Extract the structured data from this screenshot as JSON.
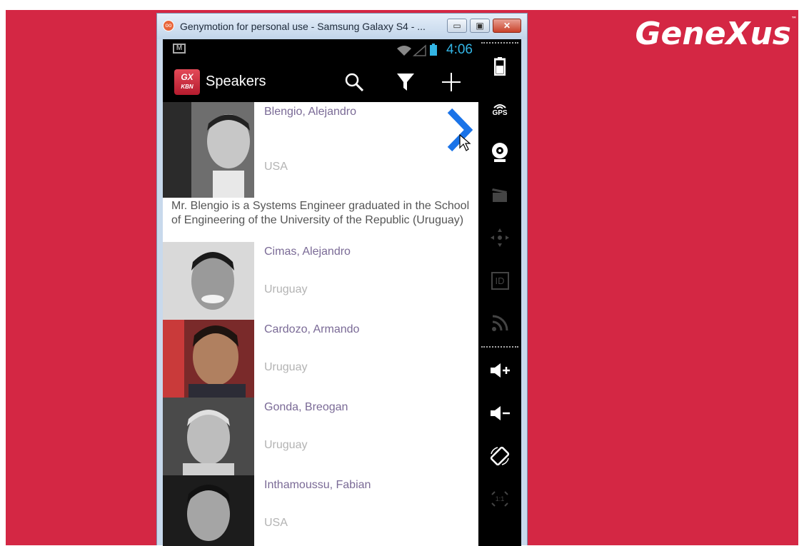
{
  "brand": {
    "name": "GeneXus",
    "tm": "™"
  },
  "window": {
    "title": "Genymotion for personal use - Samsung Galaxy S4 - ...",
    "minimize_label": "▭",
    "maximize_label": "▣",
    "close_label": "✕"
  },
  "status_bar": {
    "time": "4:06",
    "mail_icon": "gmail-icon"
  },
  "action_bar": {
    "logo_top": "GX",
    "logo_bottom": "KBN",
    "title": "Speakers",
    "actions": [
      "search-icon",
      "filter-icon",
      "add-icon"
    ]
  },
  "speakers": [
    {
      "name": "Blengio, Alejandro",
      "country": "USA",
      "bio": "Mr. Blengio is a Systems Engineer graduated in the School of Engineering of the University of the Republic (Uruguay)",
      "expanded": true
    },
    {
      "name": "Cimas, Alejandro",
      "country": "Uruguay"
    },
    {
      "name": "Cardozo, Armando",
      "country": "Uruguay"
    },
    {
      "name": "Gonda, Breogan",
      "country": "Uruguay"
    },
    {
      "name": "Inthamoussu, Fabian",
      "country": "USA"
    }
  ],
  "side_panel": {
    "gps_label": "GPS",
    "id_label": "ID",
    "ratio_label": "1:1",
    "items": [
      "battery-icon",
      "gps-icon",
      "webcam-icon",
      "clapper-icon",
      "dpad-icon",
      "id-icon",
      "rss-icon",
      "volume-up-icon",
      "volume-down-icon",
      "rotate-icon",
      "pixel-perfect-icon"
    ]
  },
  "colors": {
    "background": "#d42744",
    "accent": "#33b5e5",
    "name_text": "#7a6a96",
    "chevron": "#1a73e8"
  }
}
